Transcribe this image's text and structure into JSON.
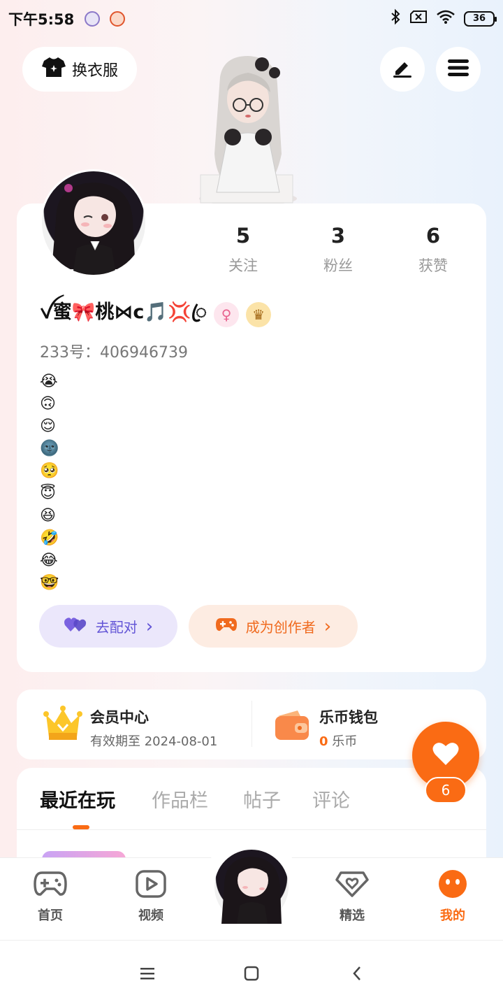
{
  "status_bar": {
    "time": "下午5:58",
    "battery": "36",
    "icons": [
      "bluetooth-icon",
      "sim-off-icon",
      "wifi-icon",
      "battery-icon"
    ]
  },
  "header": {
    "outfit_label": "换衣服",
    "edit_icon": "pen-icon",
    "menu_icon": "menu-icon"
  },
  "profile": {
    "stats": [
      {
        "value": "5",
        "label": "关注"
      },
      {
        "value": "3",
        "label": "粉丝"
      },
      {
        "value": "6",
        "label": "获赞"
      }
    ],
    "nickname": "ꪜ蜜🎀桃⋈c🎵💢ꦿ",
    "gender_symbol": "♀",
    "vip_symbol": "♛",
    "uid": "233号：406946739",
    "bio_emojis": [
      "😭",
      "🙃",
      "😌",
      "🌚",
      "🥺",
      "😇",
      "😆",
      "🤣",
      "😂",
      "🤓"
    ],
    "match_label": "去配对",
    "creator_label": "成为创作者",
    "chevron": "›"
  },
  "member": {
    "title": "会员中心",
    "subtitle": "有效期至 2024-08-01"
  },
  "wallet": {
    "title": "乐币钱包",
    "amount": "0",
    "unit": "乐币"
  },
  "like_float": {
    "count": "6"
  },
  "tabs": [
    "最近在玩",
    "作品栏",
    "帖子",
    "评论"
  ],
  "bottom_nav": [
    {
      "label": "首页",
      "icon": "gamepad-icon"
    },
    {
      "label": "视频",
      "icon": "play-icon"
    },
    {
      "label": "精选",
      "icon": "heart-tag-icon"
    },
    {
      "label": "我的",
      "icon": "face-icon"
    }
  ],
  "colors": {
    "accent": "#fa6b14",
    "match": "#6355d6",
    "match_bg": "#ebe7fb",
    "creator_bg": "#fdece2"
  }
}
